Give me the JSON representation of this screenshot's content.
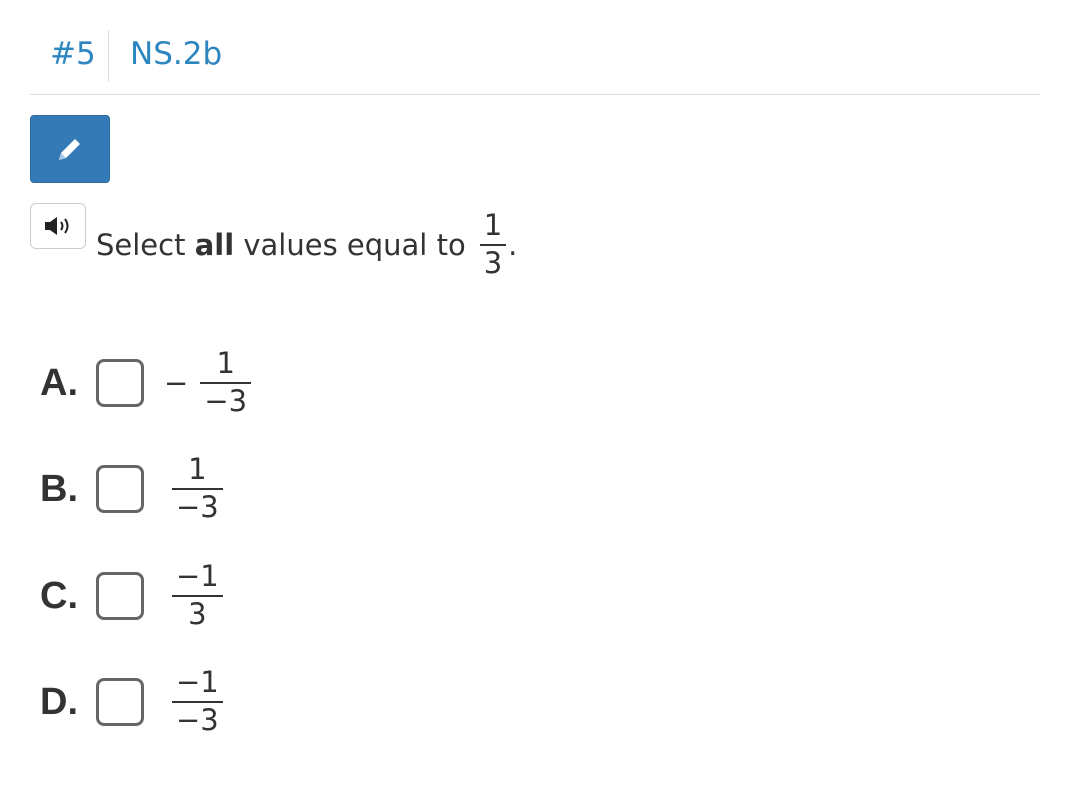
{
  "header": {
    "question_number": "#5",
    "standard": "NS.2b"
  },
  "toolbar": {
    "edit_icon": "pencil-icon",
    "audio_icon": "speaker-icon"
  },
  "prompt": {
    "before": "Select ",
    "bold": "all",
    "after": " values equal to",
    "frac_num": "1",
    "frac_den": "3",
    "end": "."
  },
  "options": [
    {
      "letter": "A.",
      "prefix": "−",
      "num": "1",
      "den": "−3"
    },
    {
      "letter": "B.",
      "prefix": "",
      "num": "1",
      "den": "−3"
    },
    {
      "letter": "C.",
      "prefix": "",
      "num": "−1",
      "den": "3"
    },
    {
      "letter": "D.",
      "prefix": "",
      "num": "−1",
      "den": "−3"
    }
  ],
  "colors": {
    "link": "#2e86c1",
    "button": "#337ab7"
  }
}
